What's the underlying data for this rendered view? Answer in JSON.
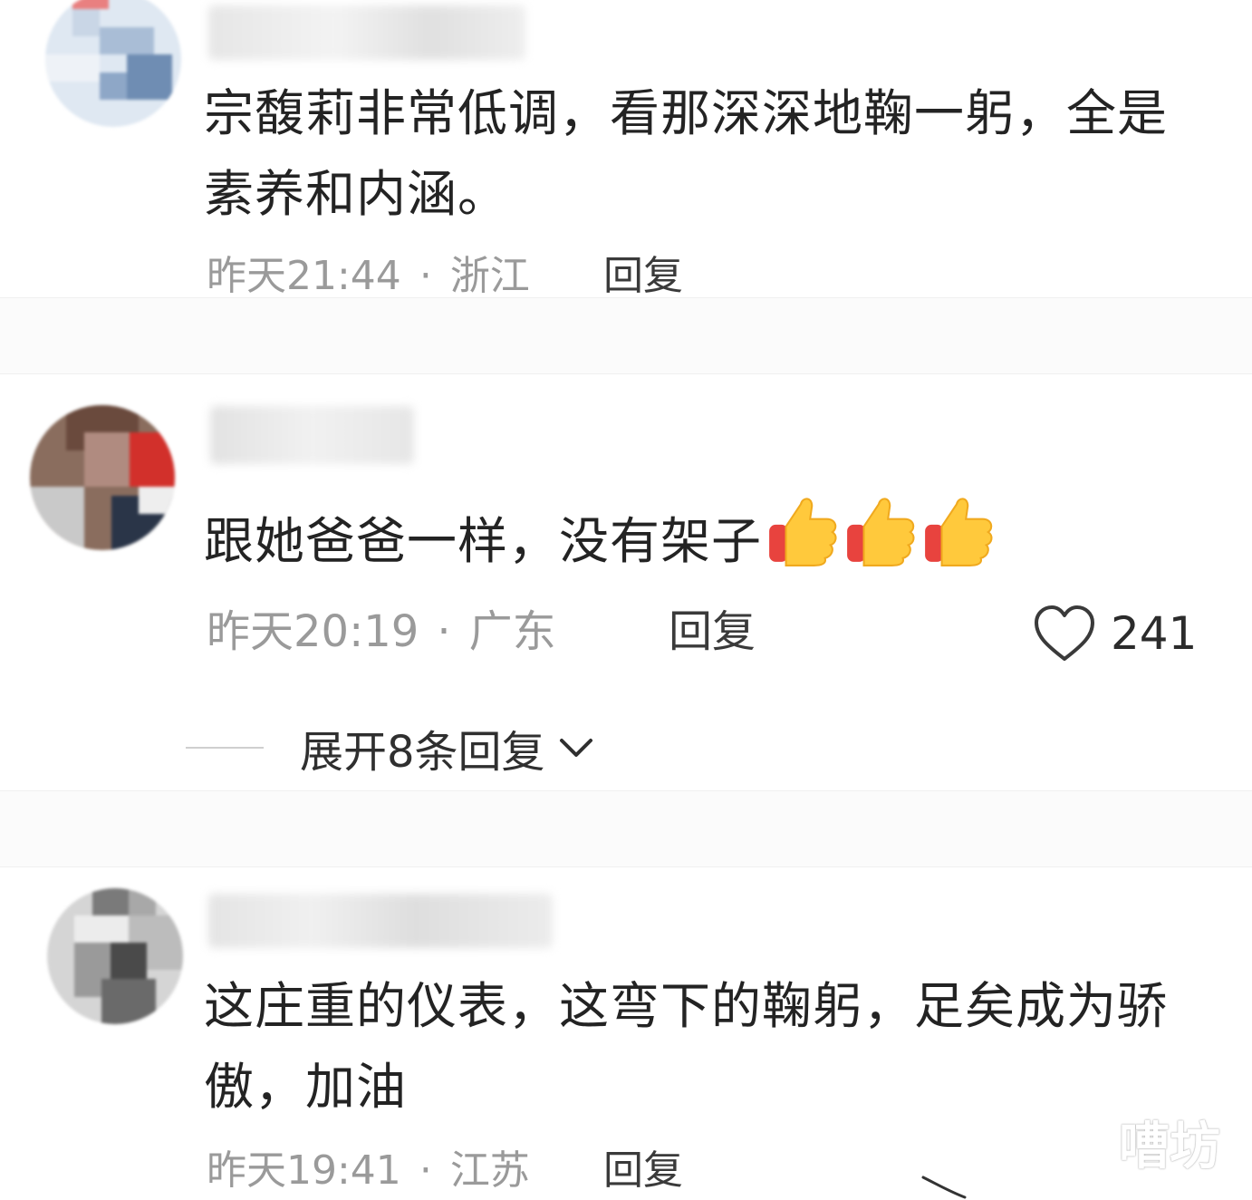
{
  "comments": [
    {
      "text": "宗馥莉非常低调，看那深深地鞠一躬，全是素养和内涵。",
      "time": "昨天21:44",
      "dot": "·",
      "location": "浙江",
      "reply_label": "回复",
      "avatar_icon": "pixelated-avatar"
    },
    {
      "text": "跟她爸爸一样，没有架子",
      "emoji": [
        "thumbs-up-icon",
        "thumbs-up-icon",
        "thumbs-up-icon"
      ],
      "time": "昨天20:19",
      "dot": "·",
      "location": "广东",
      "reply_label": "回复",
      "like_count": "241",
      "expand_label": "展开8条回复",
      "avatar_icon": "pixelated-avatar"
    },
    {
      "text": "这庄重的仪表，这弯下的鞠躬，足矣成为骄傲，加油",
      "time": "昨天19:41",
      "dot": "·",
      "location": "江苏",
      "reply_label": "回复",
      "avatar_icon": "pixelated-avatar"
    }
  ],
  "watermark": "嘈坊",
  "colors": {
    "meta_text": "#9a9a9a",
    "body_text": "#232323",
    "thumb_yellow": "#ffc93c",
    "thumb_red": "#e8433e"
  }
}
